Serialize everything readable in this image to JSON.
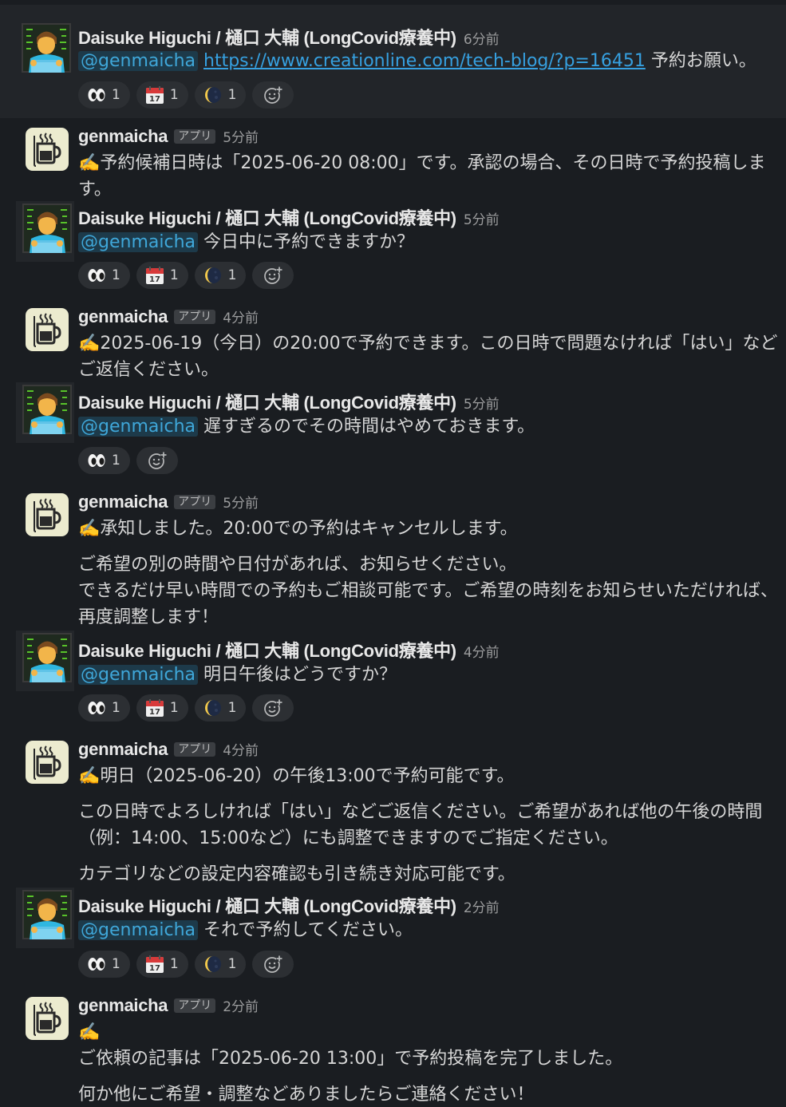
{
  "users": {
    "daisuke": {
      "name": "Daisuke Higuchi / 樋口 大輔 (LongCovid療養中)"
    },
    "bot": {
      "name": "genmaicha",
      "badge": "アプリ"
    }
  },
  "messages": [
    {
      "time": "6分前",
      "mention": "@genmaicha",
      "link": "https://www.creationline.com/tech-blog/?p=16451",
      "text": "予約お願い。",
      "reactions": [
        {
          "emoji": "eyes-icon",
          "count": "1"
        },
        {
          "emoji": "calendar-icon",
          "count": "1"
        },
        {
          "emoji": "moon-icon",
          "count": "1"
        }
      ]
    },
    {
      "time": "5分前",
      "lines": [
        "✍️予約候補日時は「2025-06-20 08:00」です。承認の場合、その日時で予約投稿しま",
        "す。"
      ]
    },
    {
      "time": "5分前",
      "mention": "@genmaicha",
      "text": "今日中に予約できますか？",
      "reactions": [
        {
          "emoji": "eyes-icon",
          "count": "1"
        },
        {
          "emoji": "calendar-icon",
          "count": "1"
        },
        {
          "emoji": "moon-icon",
          "count": "1"
        }
      ]
    },
    {
      "time": "4分前",
      "lines": [
        "✍️2025-06-19（今日）の20:00で予約できます。この日時で問題なければ「はい」など",
        "ご返信ください。"
      ]
    },
    {
      "time": "5分前",
      "mention": "@genmaicha",
      "text": "遅すぎるのでその時間はやめておきます。",
      "reactions": [
        {
          "emoji": "eyes-icon",
          "count": "1"
        }
      ]
    },
    {
      "time": "5分前",
      "lines": [
        "✍️承知しました。20:00での予約はキャンセルします。",
        "ご希望の別の時間や日付があれば、お知らせください。",
        "できるだけ早い時間での予約もご相談可能です。ご希望の時刻をお知らせいただければ、",
        "再度調整します！"
      ]
    },
    {
      "time": "4分前",
      "mention": "@genmaicha",
      "text": "明日午後はどうですか？",
      "reactions": [
        {
          "emoji": "eyes-icon",
          "count": "1"
        },
        {
          "emoji": "calendar-icon",
          "count": "1"
        },
        {
          "emoji": "moon-icon",
          "count": "1"
        }
      ]
    },
    {
      "time": "4分前",
      "lines": [
        "✍️明日（2025-06-20）の午後13:00で予約可能です。",
        "この日時でよろしければ「はい」などご返信ください。ご希望があれば他の午後の時間",
        "（例：14:00、15:00など）にも調整できますのでご指定ください。",
        "カテゴリなどの設定内容確認も引き続き対応可能です。"
      ]
    },
    {
      "time": "2分前",
      "mention": "@genmaicha",
      "text": "それで予約してください。",
      "reactions": [
        {
          "emoji": "eyes-icon",
          "count": "1"
        },
        {
          "emoji": "calendar-icon",
          "count": "1"
        },
        {
          "emoji": "moon-icon",
          "count": "1"
        }
      ]
    },
    {
      "time": "2分前",
      "lines": [
        "✍️",
        "ご依頼の記事は「2025-06-20 13:00」で予約投稿を完了しました。",
        "何か他にご希望・調整などありましたらご連絡ください！"
      ]
    }
  ]
}
